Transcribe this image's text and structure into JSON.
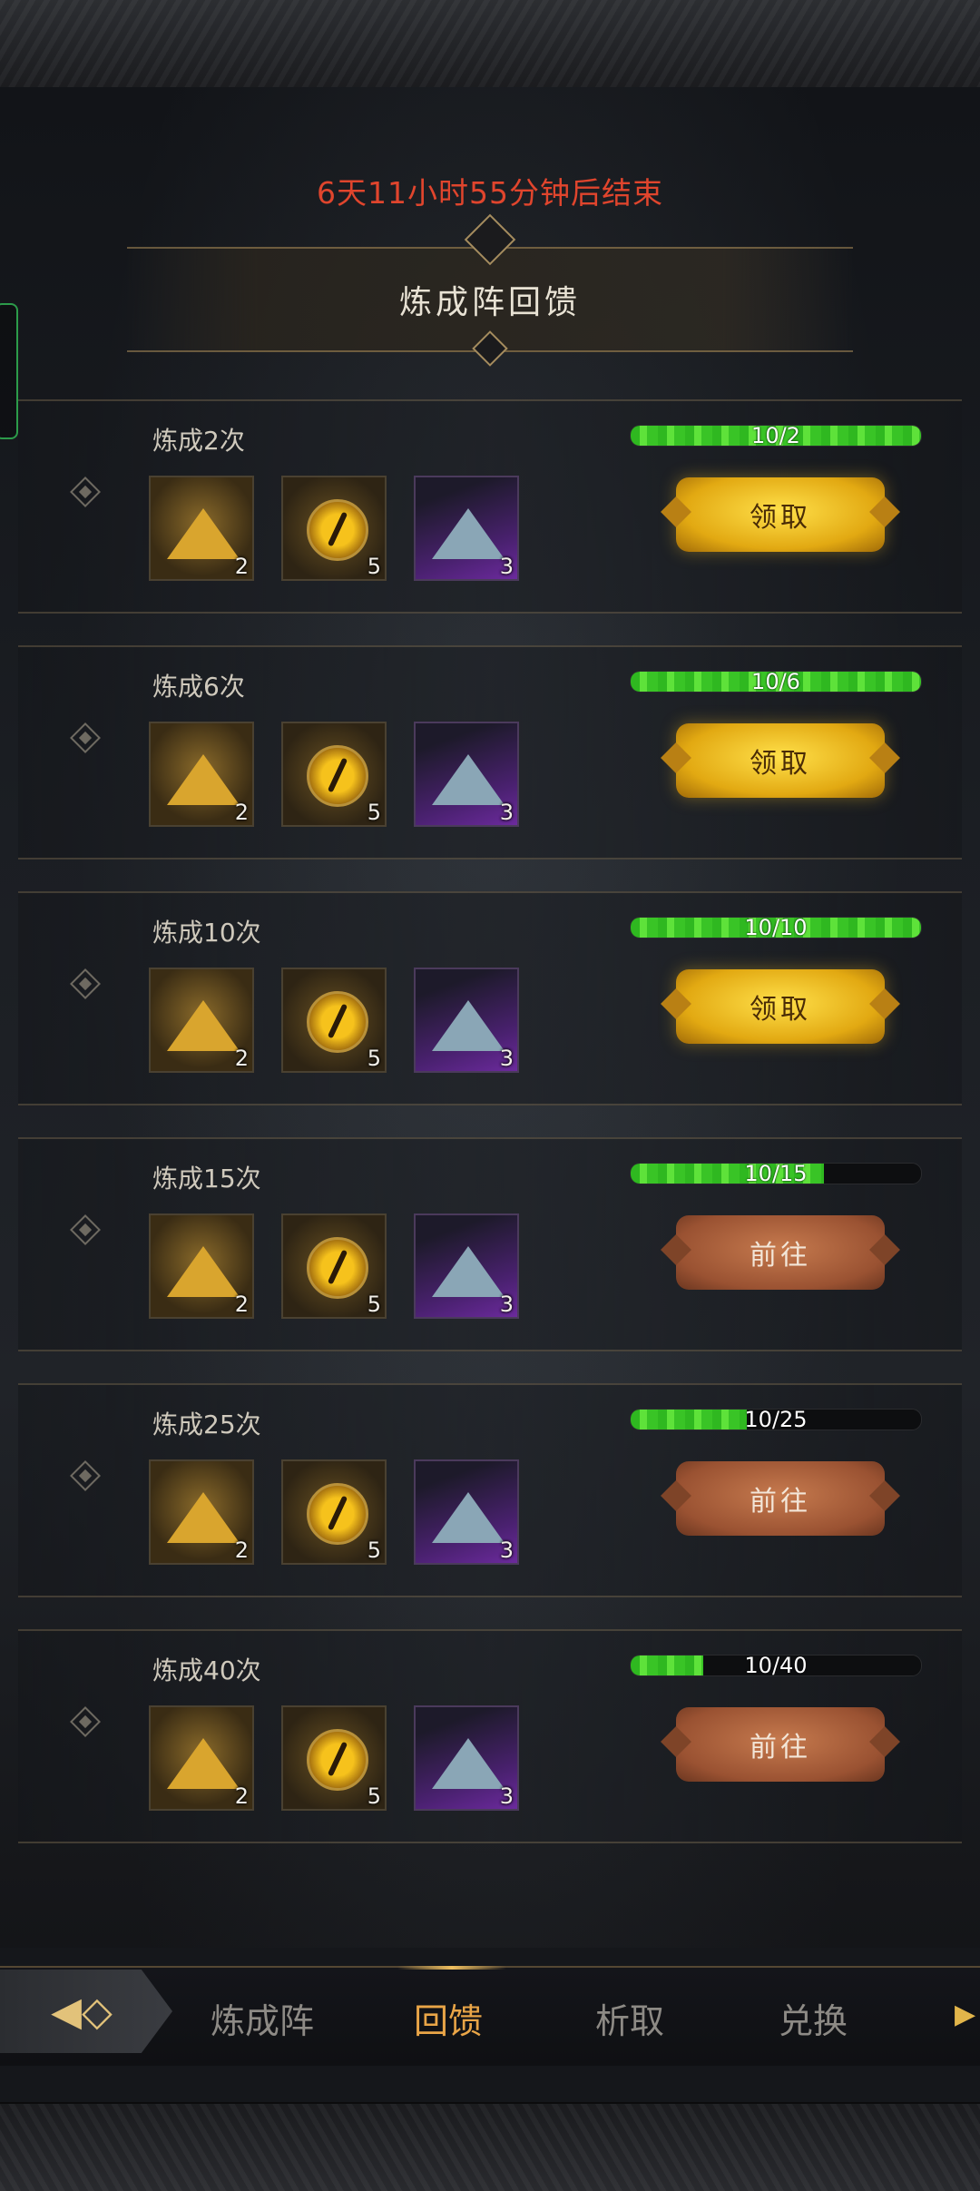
{
  "event": {
    "timer_text": "6天11小时55分钟后结束",
    "title": "炼成阵回馈"
  },
  "colors": {
    "timer": "#e0452d",
    "progress_fill": "#3cc426",
    "claim_button": "#f3c21d",
    "go_button": "#a65a38",
    "active_tab": "#e9a547"
  },
  "rewards": [
    {
      "label": "炼成2次",
      "progress_text": "10/2",
      "progress_fraction": 1.0,
      "button_label": "领取",
      "button_state": "claim",
      "items": [
        {
          "icon": "gold-pyramid-crystal",
          "count": "2"
        },
        {
          "icon": "golden-eye-medallion",
          "count": "5"
        },
        {
          "icon": "blue-crystal-pyramid",
          "count": "3"
        }
      ]
    },
    {
      "label": "炼成6次",
      "progress_text": "10/6",
      "progress_fraction": 1.0,
      "button_label": "领取",
      "button_state": "claim",
      "items": [
        {
          "icon": "gold-pyramid-crystal",
          "count": "2"
        },
        {
          "icon": "golden-eye-medallion",
          "count": "5"
        },
        {
          "icon": "blue-crystal-pyramid",
          "count": "3"
        }
      ]
    },
    {
      "label": "炼成10次",
      "progress_text": "10/10",
      "progress_fraction": 1.0,
      "button_label": "领取",
      "button_state": "claim",
      "items": [
        {
          "icon": "gold-pyramid-crystal",
          "count": "2"
        },
        {
          "icon": "golden-eye-medallion",
          "count": "5"
        },
        {
          "icon": "blue-crystal-pyramid",
          "count": "3"
        }
      ]
    },
    {
      "label": "炼成15次",
      "progress_text": "10/15",
      "progress_fraction": 0.667,
      "button_label": "前往",
      "button_state": "go",
      "items": [
        {
          "icon": "gold-pyramid-crystal",
          "count": "2"
        },
        {
          "icon": "golden-eye-medallion",
          "count": "5"
        },
        {
          "icon": "blue-crystal-pyramid",
          "count": "3"
        }
      ]
    },
    {
      "label": "炼成25次",
      "progress_text": "10/25",
      "progress_fraction": 0.4,
      "button_label": "前往",
      "button_state": "go",
      "items": [
        {
          "icon": "gold-pyramid-crystal",
          "count": "2"
        },
        {
          "icon": "golden-eye-medallion",
          "count": "5"
        },
        {
          "icon": "blue-crystal-pyramid",
          "count": "3"
        }
      ]
    },
    {
      "label": "炼成40次",
      "progress_text": "10/40",
      "progress_fraction": 0.25,
      "button_label": "前往",
      "button_state": "go",
      "items": [
        {
          "icon": "gold-pyramid-crystal",
          "count": "2"
        },
        {
          "icon": "golden-eye-medallion",
          "count": "5"
        },
        {
          "icon": "blue-crystal-pyramid",
          "count": "3"
        }
      ]
    }
  ],
  "nav": {
    "back_icon": "back-arrow-icon",
    "tabs": [
      {
        "label": "炼成阵",
        "active": false
      },
      {
        "label": "回馈",
        "active": true
      },
      {
        "label": "析取",
        "active": false
      },
      {
        "label": "兑换",
        "active": false
      }
    ],
    "more_icon": "chevron-right-icon"
  }
}
